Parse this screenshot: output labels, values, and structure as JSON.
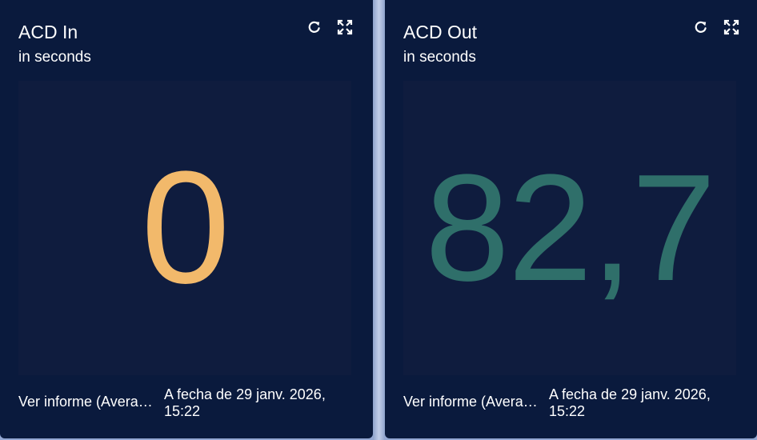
{
  "cards": [
    {
      "title": "ACD In",
      "subtitle": "in seconds",
      "value": "0",
      "value_color": "#f2b96b",
      "report_link": "Ver informe (Average...",
      "report_link_truncated": "Ver informe (Avera…",
      "date": "A fecha de 29 janv. 2026, 15:22",
      "icons": [
        "refresh-icon",
        "expand-icon"
      ]
    },
    {
      "title": "ACD Out",
      "subtitle": "in seconds",
      "value": "82,7",
      "value_color": "#2f6f6a",
      "report_link": "Ver informe (Average...",
      "report_link_truncated": "Ver informe (Avera…",
      "date": "A fecha de 29 janv. 2026, 15:22",
      "icons": [
        "refresh-icon",
        "expand-icon"
      ]
    }
  ],
  "colors": {
    "card_background": "#0a1a3d",
    "panel_background": "#0f1c3e",
    "text": "#ffffff"
  }
}
